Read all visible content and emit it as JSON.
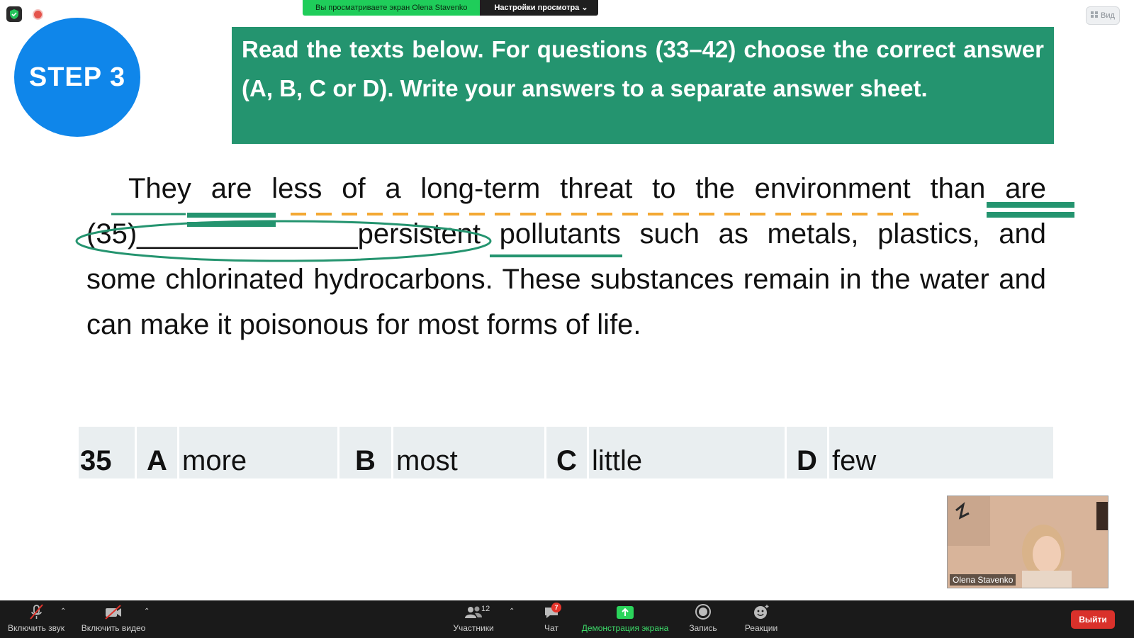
{
  "top_bar": {
    "sharing_text": "Вы просматриваете экран Olena Stavenko",
    "view_settings_label": "Настройки просмотра",
    "view_button_label": "Вид"
  },
  "slide": {
    "step_label": "STEP 3",
    "instruction": "Read the texts below. For questions (33–42) choose the correct answer (A, B, C or D). Write your answers to a separate answer sheet.",
    "passage": {
      "part1": "They are less of a long-term threat to the environment than are ",
      "gap_number": "(35)",
      "gap_blank": "______________",
      "part2": "persistent pollutants such as metals, plastics, and some chlorinated hydrocarbons. These substances remain in the water and can make it poisonous for most forms of life."
    },
    "question": {
      "number": "35",
      "options": [
        {
          "letter": "A",
          "text": "more"
        },
        {
          "letter": "B",
          "text": "most"
        },
        {
          "letter": "C",
          "text": "little"
        },
        {
          "letter": "D",
          "text": "few"
        }
      ]
    },
    "annotation_colors": {
      "green": "#24946f",
      "orange": "#f3a833"
    }
  },
  "video": {
    "participant_name": "Olena Stavenko"
  },
  "toolbar": {
    "unmute_label": "Включить звук",
    "start_video_label": "Включить видео",
    "participants_label": "Участники",
    "participants_count": "12",
    "chat_label": "Чат",
    "chat_badge": "7",
    "share_screen_label": "Демонстрация экрана",
    "record_label": "Запись",
    "reactions_label": "Реакции",
    "exit_label": "Выйти"
  }
}
